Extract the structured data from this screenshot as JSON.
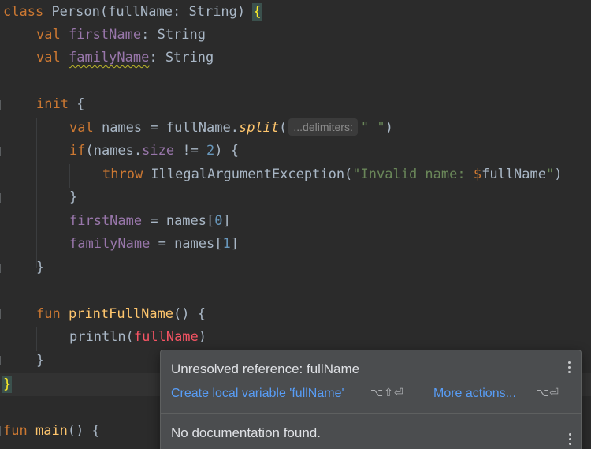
{
  "code": {
    "l1": {
      "kw": "class",
      "name": "Person",
      "open": "(",
      "param": "fullName",
      "colon": ": ",
      "type": "String",
      "close": ") ",
      "brace": "{"
    },
    "l2": {
      "kw": "val",
      "prop": "firstName",
      "colon": ": ",
      "type": "String"
    },
    "l3": {
      "kw": "val",
      "prop": "familyName",
      "colon": ": ",
      "type": "String"
    },
    "l5": {
      "kw": "init",
      "rest": " {"
    },
    "l6": {
      "kw": "val",
      "pre": " names = fullName.",
      "fn": "split",
      "open": "(",
      "hint": "...delimiters:",
      "arg": "\" \"",
      "close": ")"
    },
    "l7": {
      "kw": "if",
      "pre": "(names.",
      "prop": "size",
      "op": " != ",
      "num": "2",
      "rest": ") {"
    },
    "l8": {
      "kw": "throw",
      "pre": " IllegalArgumentException(",
      "str": "\"Invalid name: ",
      "tpl": "$",
      "tplvar": "fullName",
      "strEnd": "\"",
      "close": ")"
    },
    "l9": {
      "text": "}"
    },
    "l10": {
      "prop": "firstName",
      "pre": " = names[",
      "num": "0",
      "close": "]"
    },
    "l11": {
      "prop": "familyName",
      "pre": " = names[",
      "num": "1",
      "close": "]"
    },
    "l12": {
      "text": "}"
    },
    "l14": {
      "kw": "fun",
      "fn": "printFullName",
      "rest": "() {"
    },
    "l15": {
      "pre": "println(",
      "err": "fullName",
      "close": ")"
    },
    "l16": {
      "text": "}"
    },
    "l17": {
      "brace": "}"
    },
    "l19": {
      "kw": "fun",
      "fn": "main",
      "rest": "() {"
    }
  },
  "popup": {
    "title": "Unresolved reference: fullName",
    "action_create": "Create local variable 'fullName'",
    "shortcut_create": "⌥⇧⏎",
    "action_more": "More actions...",
    "shortcut_more": "⌥⏎",
    "documentation": "No documentation found."
  }
}
